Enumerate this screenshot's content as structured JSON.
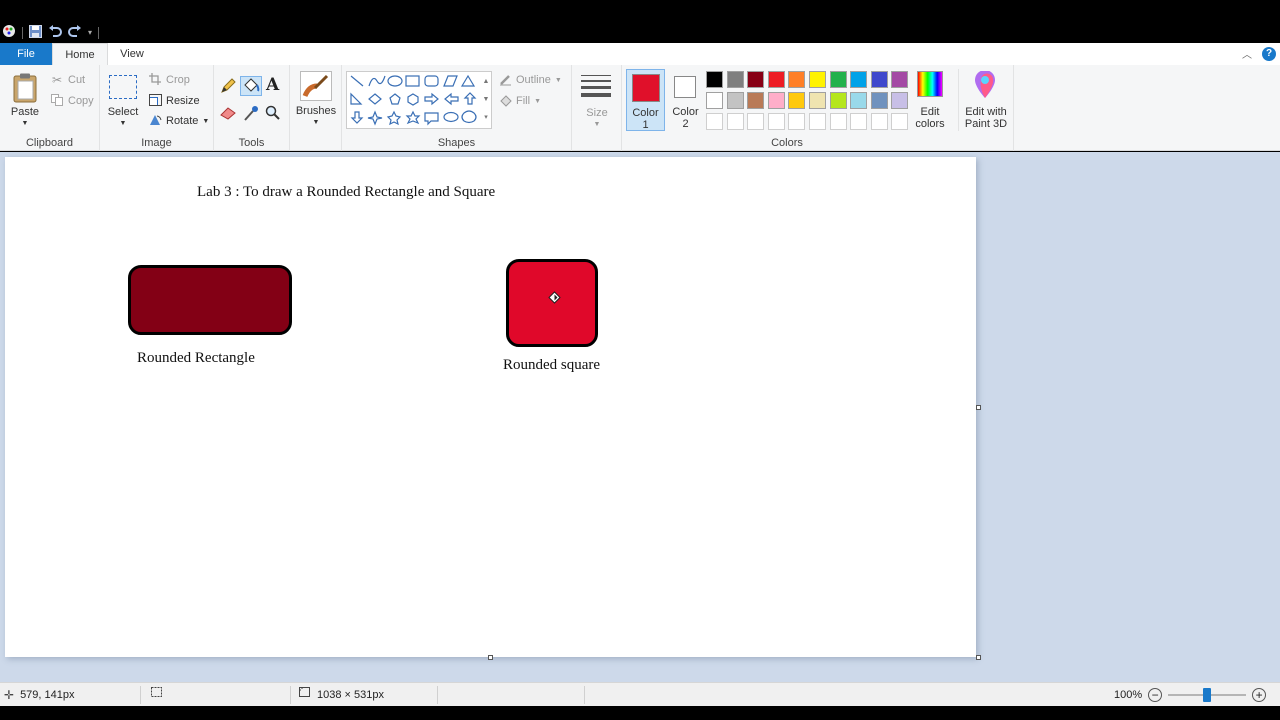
{
  "quick_access": {
    "save_icon": "save-icon",
    "undo_icon": "undo-icon",
    "redo_icon": "redo-icon"
  },
  "tabs": [
    {
      "label": "File"
    },
    {
      "label": "Home"
    },
    {
      "label": "View"
    }
  ],
  "clipboard": {
    "paste": "Paste",
    "cut": "Cut",
    "copy": "Copy",
    "group": "Clipboard"
  },
  "image": {
    "select": "Select",
    "crop": "Crop",
    "resize": "Resize",
    "rotate": "Rotate",
    "group": "Image"
  },
  "tools": {
    "group": "Tools"
  },
  "brushes": {
    "label": "Brushes"
  },
  "shapes": {
    "outline": "Outline",
    "fill": "Fill",
    "group": "Shapes"
  },
  "size": {
    "label": "Size"
  },
  "colors": {
    "color1_label": "Color",
    "color1_num": "1",
    "color2_label": "Color",
    "color2_num": "2",
    "color1": "#e0102a",
    "color2": "#ffffff",
    "edit_colors": "Edit colors",
    "edit_paint3d": "Edit with Paint 3D",
    "group": "Colors",
    "palette_row1": [
      "#000000",
      "#7f7f7f",
      "#880015",
      "#ed1c24",
      "#ff7f27",
      "#fff200",
      "#22b14c",
      "#00a2e8",
      "#3f48cc",
      "#a349a4"
    ],
    "palette_row2": [
      "#ffffff",
      "#c3c3c3",
      "#b97a57",
      "#ffaec9",
      "#ffc90e",
      "#efe4b0",
      "#b5e61d",
      "#99d9ea",
      "#7092be",
      "#c8bfe7"
    ]
  },
  "canvas": {
    "title": "Lab 3 : To draw a Rounded Rectangle and Square",
    "rect_label": "Rounded Rectangle",
    "square_label": "Rounded square",
    "rect_fill": "#830015",
    "square_fill": "#e0082a"
  },
  "status": {
    "cursor_pos": "579, 141px",
    "image_size": "1038 × 531px",
    "zoom": "100%",
    "zoom_fraction": 0.5
  }
}
